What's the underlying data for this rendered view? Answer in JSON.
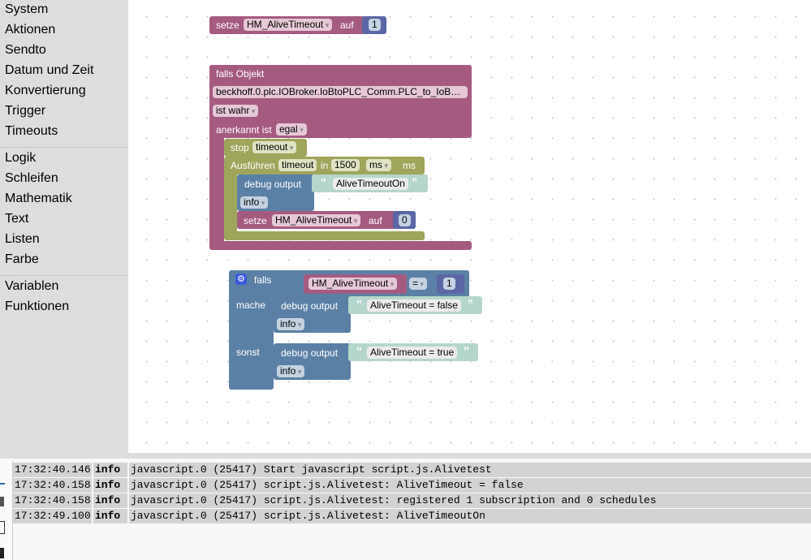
{
  "sidebar": {
    "groups": [
      [
        "System",
        "Aktionen",
        "Sendto",
        "Datum und Zeit",
        "Konvertierung",
        "Trigger",
        "Timeouts"
      ],
      [
        "Logik",
        "Schleifen",
        "Mathematik",
        "Text",
        "Listen",
        "Farbe"
      ],
      [
        "Variablen",
        "Funktionen"
      ]
    ]
  },
  "colors": {
    "event": "#a55b80",
    "timeout": "#9fa55b",
    "logic": "#5b80a5",
    "text": "#b5d6cc",
    "number": "#5b67a5"
  },
  "block1": {
    "setze": "setze",
    "var": "HM_AliveTimeout",
    "auf": "auf",
    "value": "1"
  },
  "block2": {
    "title": "falls Objekt",
    "object": "beckhoff.0.plc.IOBroker.IoBtoPLC_Comm.PLC_to_IoB…",
    "cond": "ist wahr",
    "ack_label": "anerkannt ist",
    "ack": "egal",
    "stop": "stop",
    "stop_var": "timeout",
    "exec": "Ausführen",
    "exec_var": "timeout",
    "in": "in",
    "delay": "1500",
    "unit": "ms",
    "unit2": "ms",
    "debug": "debug output",
    "debug_text": "AliveTimeoutOn",
    "debug_level": "info",
    "setze": "setze",
    "var": "HM_AliveTimeout",
    "auf": "auf",
    "value": "0"
  },
  "block3": {
    "falls": "falls",
    "var": "HM_AliveTimeout",
    "op": "=",
    "value": "1",
    "mache": "mache",
    "sonst": "sonst",
    "debug1": "debug output",
    "text1": "AliveTimeout = false",
    "level1": "info",
    "debug2": "debug output",
    "text2": "AliveTimeout = true",
    "level2": "info"
  },
  "log": [
    {
      "time": "17:32:40.146",
      "level": "info",
      "msg": "javascript.0 (25417) Start javascript script.js.Alivetest"
    },
    {
      "time": "17:32:40.158",
      "level": "info",
      "msg": "javascript.0 (25417) script.js.Alivetest: AliveTimeout = false"
    },
    {
      "time": "17:32:40.158",
      "level": "info",
      "msg": "javascript.0 (25417) script.js.Alivetest: registered 1 subscription and 0 schedules"
    },
    {
      "time": "17:32:49.100",
      "level": "info",
      "msg": "javascript.0 (25417) script.js.Alivetest: AliveTimeoutOn"
    }
  ]
}
